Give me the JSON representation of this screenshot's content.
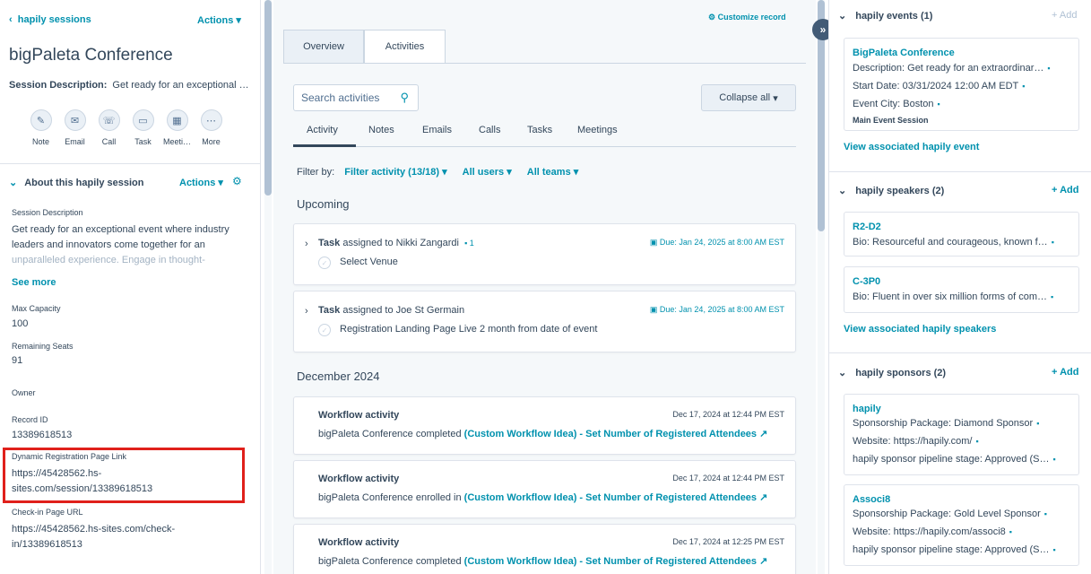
{
  "left": {
    "back_label": "hapily sessions",
    "actions_label": "Actions",
    "record_title": "bigPaleta Conference",
    "session_desc_label": "Session Description:",
    "session_desc_value": "Get ready for an exceptional …",
    "quick_actions": [
      {
        "label": "Note",
        "icon": "note-icon"
      },
      {
        "label": "Email",
        "icon": "email-icon"
      },
      {
        "label": "Call",
        "icon": "call-icon"
      },
      {
        "label": "Task",
        "icon": "task-icon"
      },
      {
        "label": "Meeti…",
        "icon": "meeting-icon"
      },
      {
        "label": "More",
        "icon": "more-icon"
      }
    ],
    "about_title": "About this hapily session",
    "about_actions": "Actions",
    "props": {
      "desc_label": "Session Description",
      "desc_line1": "Get ready for an exceptional event where industry",
      "desc_line2": "leaders and innovators come together for an",
      "desc_line3": "unparalleled experience. Engage in thought-",
      "see_more": "See more",
      "max_cap_label": "Max Capacity",
      "max_cap_value": "100",
      "remaining_label": "Remaining Seats",
      "remaining_value": "91",
      "owner_label": "Owner",
      "record_id_label": "Record ID",
      "record_id_value": "13389618513",
      "dyn_link_label": "Dynamic Registration Page Link",
      "dyn_link_line1": "https://45428562.hs-",
      "dyn_link_line2": "sites.com/session/13389618513",
      "checkin_label": "Check-in Page URL",
      "checkin_line1": "https://45428562.hs-sites.com/check-",
      "checkin_line2": "in/13389618513"
    }
  },
  "mid": {
    "customize": "Customize record",
    "tabs": {
      "overview": "Overview",
      "activities": "Activities"
    },
    "search_placeholder": "Search activities",
    "collapse_all": "Collapse all",
    "subtabs": [
      "Activity",
      "Notes",
      "Emails",
      "Calls",
      "Tasks",
      "Meetings"
    ],
    "filter_by": "Filter by:",
    "filter_activity": "Filter activity (13/18)",
    "filter_users": "All users",
    "filter_teams": "All teams",
    "upcoming": "Upcoming",
    "tasks": [
      {
        "prefix": "Task",
        "assigned": "assigned to Nikki Zangardi",
        "comments": "1",
        "due": "Due: Jan 24, 2025 at 8:00 AM EST",
        "name": "Select Venue"
      },
      {
        "prefix": "Task",
        "assigned": "assigned to Joe St Germain",
        "comments": "",
        "due": "Due: Jan 24, 2025 at 8:00 AM EST",
        "name": "Registration Landing Page Live 2 month from date of event"
      }
    ],
    "month_header": "December 2024",
    "workflows": [
      {
        "title": "Workflow activity",
        "time": "Dec 17, 2024 at 12:44 PM EST",
        "body": "bigPaleta Conference completed",
        "link": "(Custom Workflow Idea) - Set Number of Registered Attendees"
      },
      {
        "title": "Workflow activity",
        "time": "Dec 17, 2024 at 12:44 PM EST",
        "body": "bigPaleta Conference enrolled in",
        "link": "(Custom Workflow Idea) - Set Number of Registered Attendees"
      },
      {
        "title": "Workflow activity",
        "time": "Dec 17, 2024 at 12:25 PM EST",
        "body": "bigPaleta Conference completed",
        "link": "(Custom Workflow Idea) - Set Number of Registered Attendees"
      }
    ]
  },
  "right": {
    "events": {
      "title": "hapily events (1)",
      "add": "+ Add",
      "card": {
        "name": "BigPaleta Conference",
        "desc": "Description:  Get ready for an extraordinar…",
        "start": "Start Date:  03/31/2024 12:00 AM EDT",
        "city": "Event City:  Boston",
        "tag": "Main Event Session"
      },
      "view": "View associated hapily event"
    },
    "speakers": {
      "title": "hapily speakers (2)",
      "add": "+ Add",
      "cards": [
        {
          "name": "R2-D2",
          "bio": "Bio:  Resourceful and courageous, known f…"
        },
        {
          "name": "C-3P0",
          "bio": "Bio:  Fluent in over six million forms of com…"
        }
      ],
      "view": "View associated hapily speakers"
    },
    "sponsors": {
      "title": "hapily sponsors (2)",
      "add": "+ Add",
      "cards": [
        {
          "name": "hapily",
          "pkg": "Sponsorship Package:  Diamond Sponsor",
          "web": "Website:  https://hapily.com/",
          "stage": "hapily sponsor pipeline stage:  Approved (S…"
        },
        {
          "name": "Associ8",
          "pkg": "Sponsorship Package:  Gold Level Sponsor",
          "web": "Website:  https://hapily.com/associ8",
          "stage": "hapily sponsor pipeline stage:  Approved (S…"
        }
      ]
    }
  },
  "colors": {
    "accent": "#0091ae",
    "text": "#33475b",
    "highlight": "#e0201b",
    "dark_button": "#425b76"
  }
}
